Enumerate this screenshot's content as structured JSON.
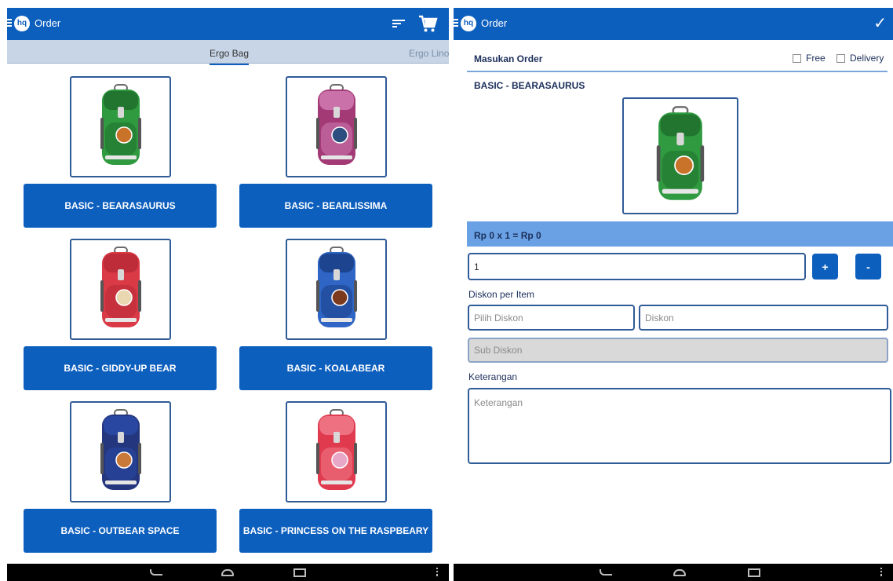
{
  "left_screen": {
    "app_title": "Order",
    "logo_text": "hq",
    "tabs": {
      "active": "Ergo Bag",
      "next_partial": "Ergo Lino"
    },
    "products": [
      {
        "name": "BASIC - BEARASAURUS",
        "bag_color": "#2f9a3f",
        "accent": "#1f6f2d",
        "patch": "#c8722a"
      },
      {
        "name": "BASIC - BEARLISSIMA",
        "bag_color": "#a33a76",
        "accent": "#d07bb2",
        "patch": "#2d4f7f"
      },
      {
        "name": "BASIC - GIDDY-UP BEAR",
        "bag_color": "#d93a46",
        "accent": "#b82a37",
        "patch": "#e8d7b0"
      },
      {
        "name": "BASIC - KOALABEAR",
        "bag_color": "#2f65c4",
        "accent": "#1a3f86",
        "patch": "#7b3a1e"
      },
      {
        "name": "BASIC - OUTBEAR SPACE",
        "bag_color": "#23367e",
        "accent": "#2a4aa6",
        "patch": "#c97a3a"
      },
      {
        "name": "BASIC - PRINCESS ON THE RASPBEARY",
        "bag_color": "#e03a4f",
        "accent": "#f07b8a",
        "patch": "#e8a7c7"
      }
    ]
  },
  "right_screen": {
    "app_title": "Order",
    "logo_text": "hq",
    "section_title": "Masukan Order",
    "free_label": "Free",
    "delivery_label": "Delivery",
    "product_name": "BASIC - BEARASAURUS",
    "price_line": "Rp 0 x 1 = Rp 0",
    "quantity_value": "1",
    "plus_label": "+",
    "minus_label": "-",
    "discount_label": "Diskon per Item",
    "pilih_diskon_placeholder": "Pilih Diskon",
    "diskon_placeholder": "Diskon",
    "sub_diskon_placeholder": "Sub Diskon",
    "keterangan_label": "Keterangan",
    "keterangan_placeholder": "Keterangan"
  },
  "icons": [
    "menu-icon",
    "hq-logo",
    "sort-icon",
    "cart-icon",
    "check-icon",
    "nav-back-icon",
    "nav-home-icon",
    "nav-recent-icon",
    "overflow-icon"
  ],
  "colors": {
    "primary": "#0d5fbe",
    "tab_bg": "#c7d5e6",
    "price_band": "#6aa1e4",
    "text_dark": "#1b2f5a"
  }
}
